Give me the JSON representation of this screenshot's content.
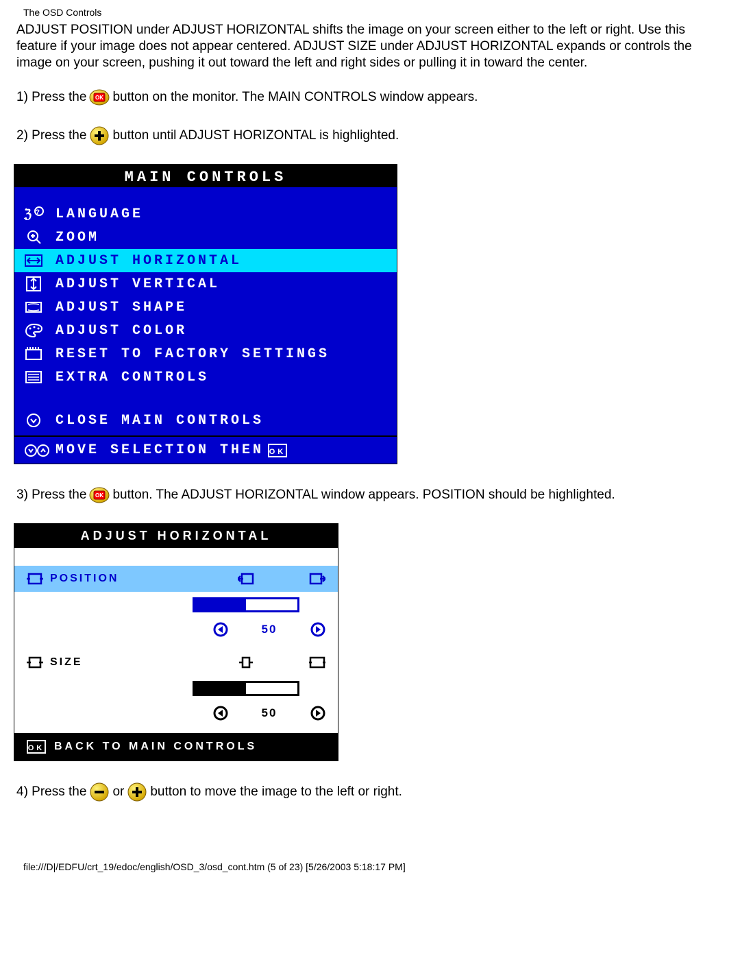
{
  "header": "The OSD Controls",
  "intro": "ADJUST POSITION under ADJUST HORIZONTAL shifts the image on your screen either to the left or right. Use this feature if your image does not appear centered. ADJUST SIZE under ADJUST HORIZONTAL expands or controls the image on your screen, pushing it out toward the left and right sides or pulling it in toward the center.",
  "step1": {
    "a": "1) Press the",
    "b": "button on the monitor. The MAIN CONTROLS window appears."
  },
  "step2": {
    "a": "2) Press the",
    "b": "button until ADJUST HORIZONTAL is highlighted."
  },
  "step3": {
    "a": "3) Press the",
    "b": "button. The ADJUST HORIZONTAL window appears. POSITION should be highlighted."
  },
  "step4": {
    "a": "4) Press the",
    "b": "or",
    "c": "button to move the image to the left or right."
  },
  "osd": {
    "title": "MAIN CONTROLS",
    "items": [
      "LANGUAGE",
      "ZOOM",
      "ADJUST HORIZONTAL",
      "ADJUST VERTICAL",
      "ADJUST SHAPE",
      "ADJUST COLOR",
      "RESET TO FACTORY SETTINGS",
      "EXTRA CONTROLS"
    ],
    "close": "CLOSE MAIN CONTROLS",
    "footer": "MOVE SELECTION THEN"
  },
  "ah": {
    "title": "Adjust Horizontal",
    "position": "Position",
    "size": "Size",
    "pos_value": "50",
    "size_value": "50",
    "back": "Back to Main Controls"
  },
  "footer": "file:///D|/EDFU/crt_19/edoc/english/OSD_3/osd_cont.htm (5 of 23) [5/26/2003 5:18:17 PM]"
}
